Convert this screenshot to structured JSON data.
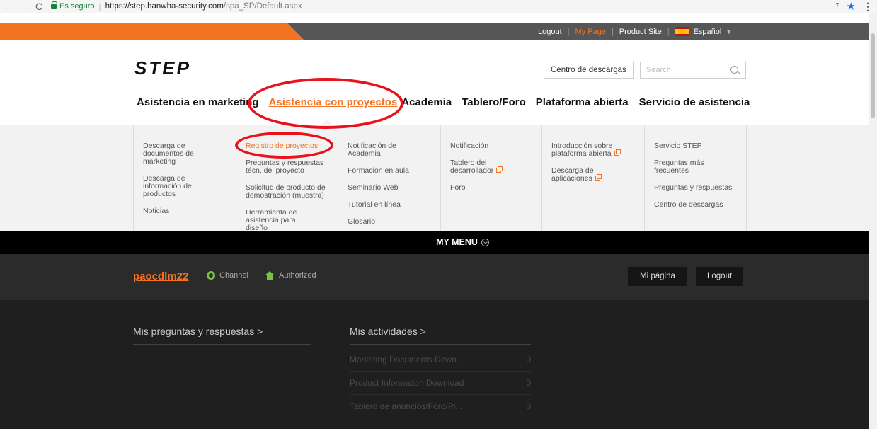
{
  "browser": {
    "secure_label": "Es seguro",
    "url_host": "https://step.hanwha-security.com",
    "url_path": "/spa_SP/Default.aspx"
  },
  "topbar": {
    "logout": "Logout",
    "mypage": "My Page",
    "product_site": "Product Site",
    "language": "Español",
    "colors": {
      "accent": "#f37321",
      "bar": "#565656"
    }
  },
  "header": {
    "logo": "STEP",
    "download_center": "Centro de descargas",
    "search_placeholder": "Search"
  },
  "nav": {
    "items": [
      "Asistencia en marketing",
      "Asistencia con proyectos",
      "Academia",
      "Tablero/Foro",
      "Plataforma abierta",
      "Servicio de asistencia"
    ]
  },
  "dropdown": {
    "col1": [
      "Descarga de documentos de marketing",
      "Descarga de información de productos",
      "Noticias"
    ],
    "col2": [
      "Registro de proyectos",
      "Preguntas y respuestas técn. del proyecto",
      "Solicitud de producto de demostración (muestra)",
      "Herramienta de asistencia para diseño"
    ],
    "col3": [
      "Notificación de Academia",
      "Formación en aula",
      "Seminario Web",
      "Tutorial en línea",
      "Glosario"
    ],
    "col4": [
      "Notificación",
      "Tablero del desarrollador",
      "Foro"
    ],
    "col5": [
      "Introducción sobre plataforma abierta",
      "Descarga de aplicaciones"
    ],
    "col6": [
      "Servicio STEP",
      "Preguntas más frecuentes",
      "Preguntas y respuestas",
      "Centro de descargas"
    ]
  },
  "mymenu": {
    "label": "MY MENU"
  },
  "user": {
    "name": "paocdlm22",
    "badge1": "Channel",
    "badge2": "Authorized",
    "btn_mypage": "Mi página",
    "btn_logout": "Logout"
  },
  "main": {
    "qa_title": "Mis preguntas y respuestas >",
    "activities_title": "Mis actividades >",
    "activities": [
      {
        "label": "Marketing Documents Down...",
        "count": "0"
      },
      {
        "label": "Product Information Download",
        "count": "0"
      },
      {
        "label": "Tablero de anuncios/Foro/Pl...",
        "count": "0"
      }
    ]
  }
}
